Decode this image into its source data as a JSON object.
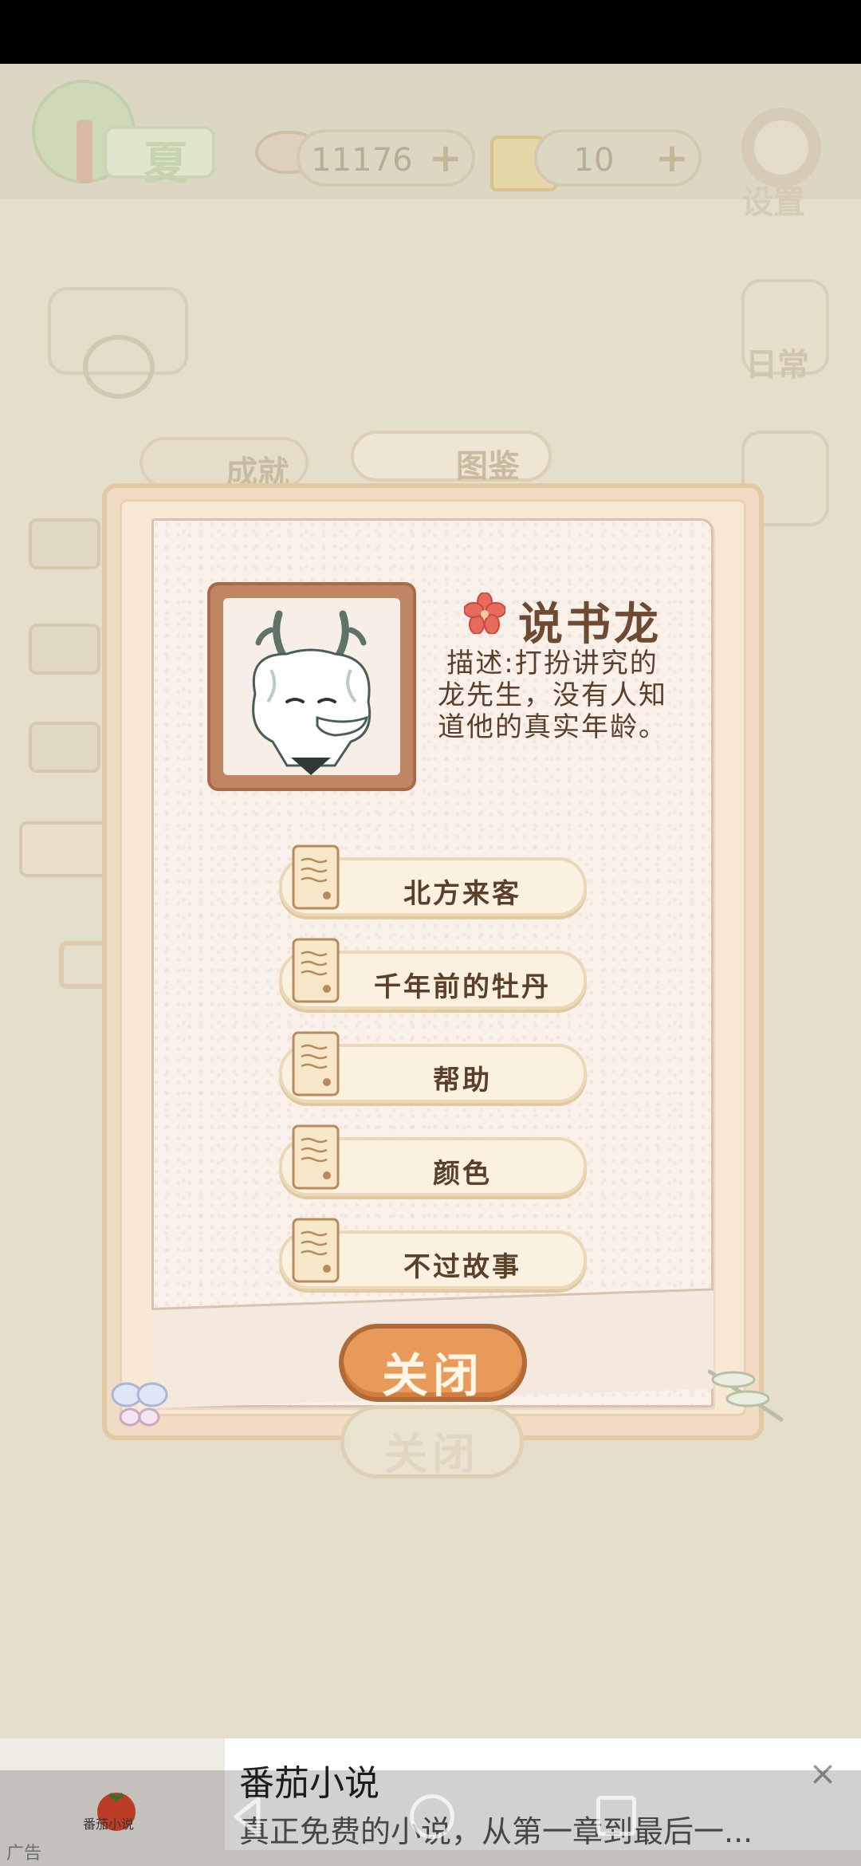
{
  "hud": {
    "season_label": "夏",
    "fish_count": "11176",
    "cheese_count": "10",
    "plus_symbol": "+",
    "settings_label": "设置"
  },
  "background": {
    "daily_label": "日常",
    "tab_achievements": "成就",
    "tab_collection": "图鉴"
  },
  "character": {
    "name": "说书龙",
    "description": "描述:打扮讲究的龙先生，没有人知道他的真实年龄。"
  },
  "stories": [
    {
      "title": "北方来客"
    },
    {
      "title": "千年前的牡丹"
    },
    {
      "title": "帮助"
    },
    {
      "title": "颜色"
    },
    {
      "title": "不过故事"
    }
  ],
  "modal": {
    "close_label": "关闭",
    "ghost_close_label": "关闭"
  },
  "ad": {
    "app_name": "番茄小说",
    "logo_text": "番茄小说",
    "description": "真正免费的小说，从第一章到最后一...",
    "ad_tag": "广告",
    "close_symbol": "×"
  },
  "colors": {
    "close_button": "#e79a59",
    "paper": "#f9f1ea",
    "frame": "#f0dcc2"
  }
}
